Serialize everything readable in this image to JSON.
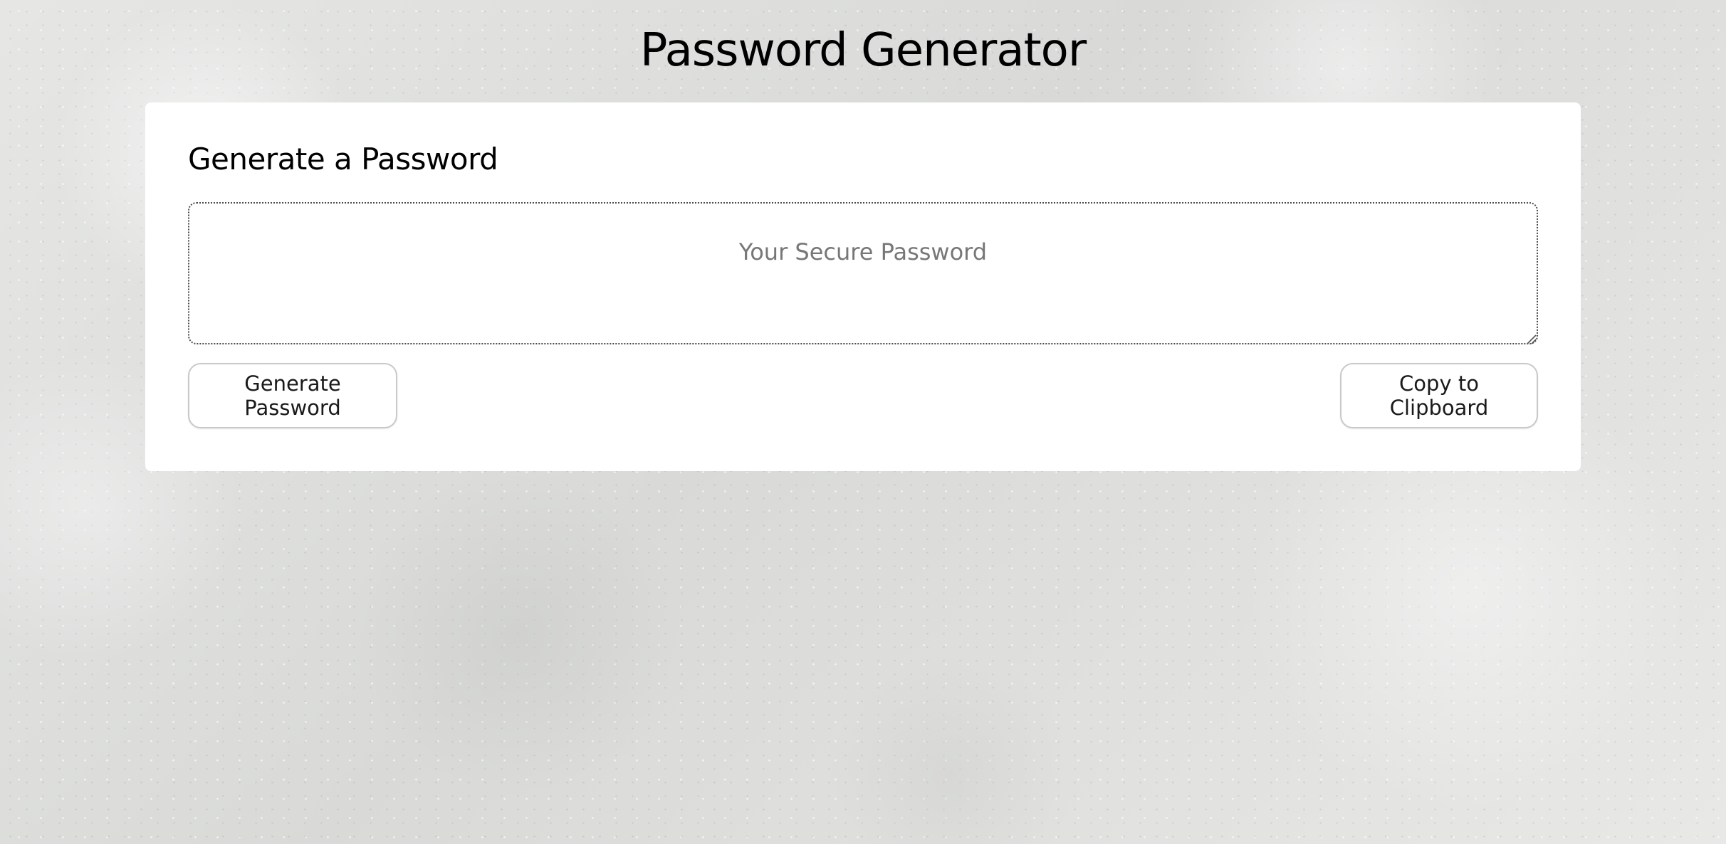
{
  "header": {
    "title": "Password Generator"
  },
  "card": {
    "title": "Generate a Password",
    "password_field": {
      "value": "",
      "placeholder": "Your Secure Password"
    },
    "generate_button_label": "Generate Password",
    "copy_button_label": "Copy to Clipboard"
  },
  "colors": {
    "background": "#e2e3e1",
    "card": "#ffffff",
    "placeholder_text": "#777777",
    "button_border": "#c9c9c9"
  },
  "icons": {
    "textarea_resize": "resize-grip-icon"
  }
}
